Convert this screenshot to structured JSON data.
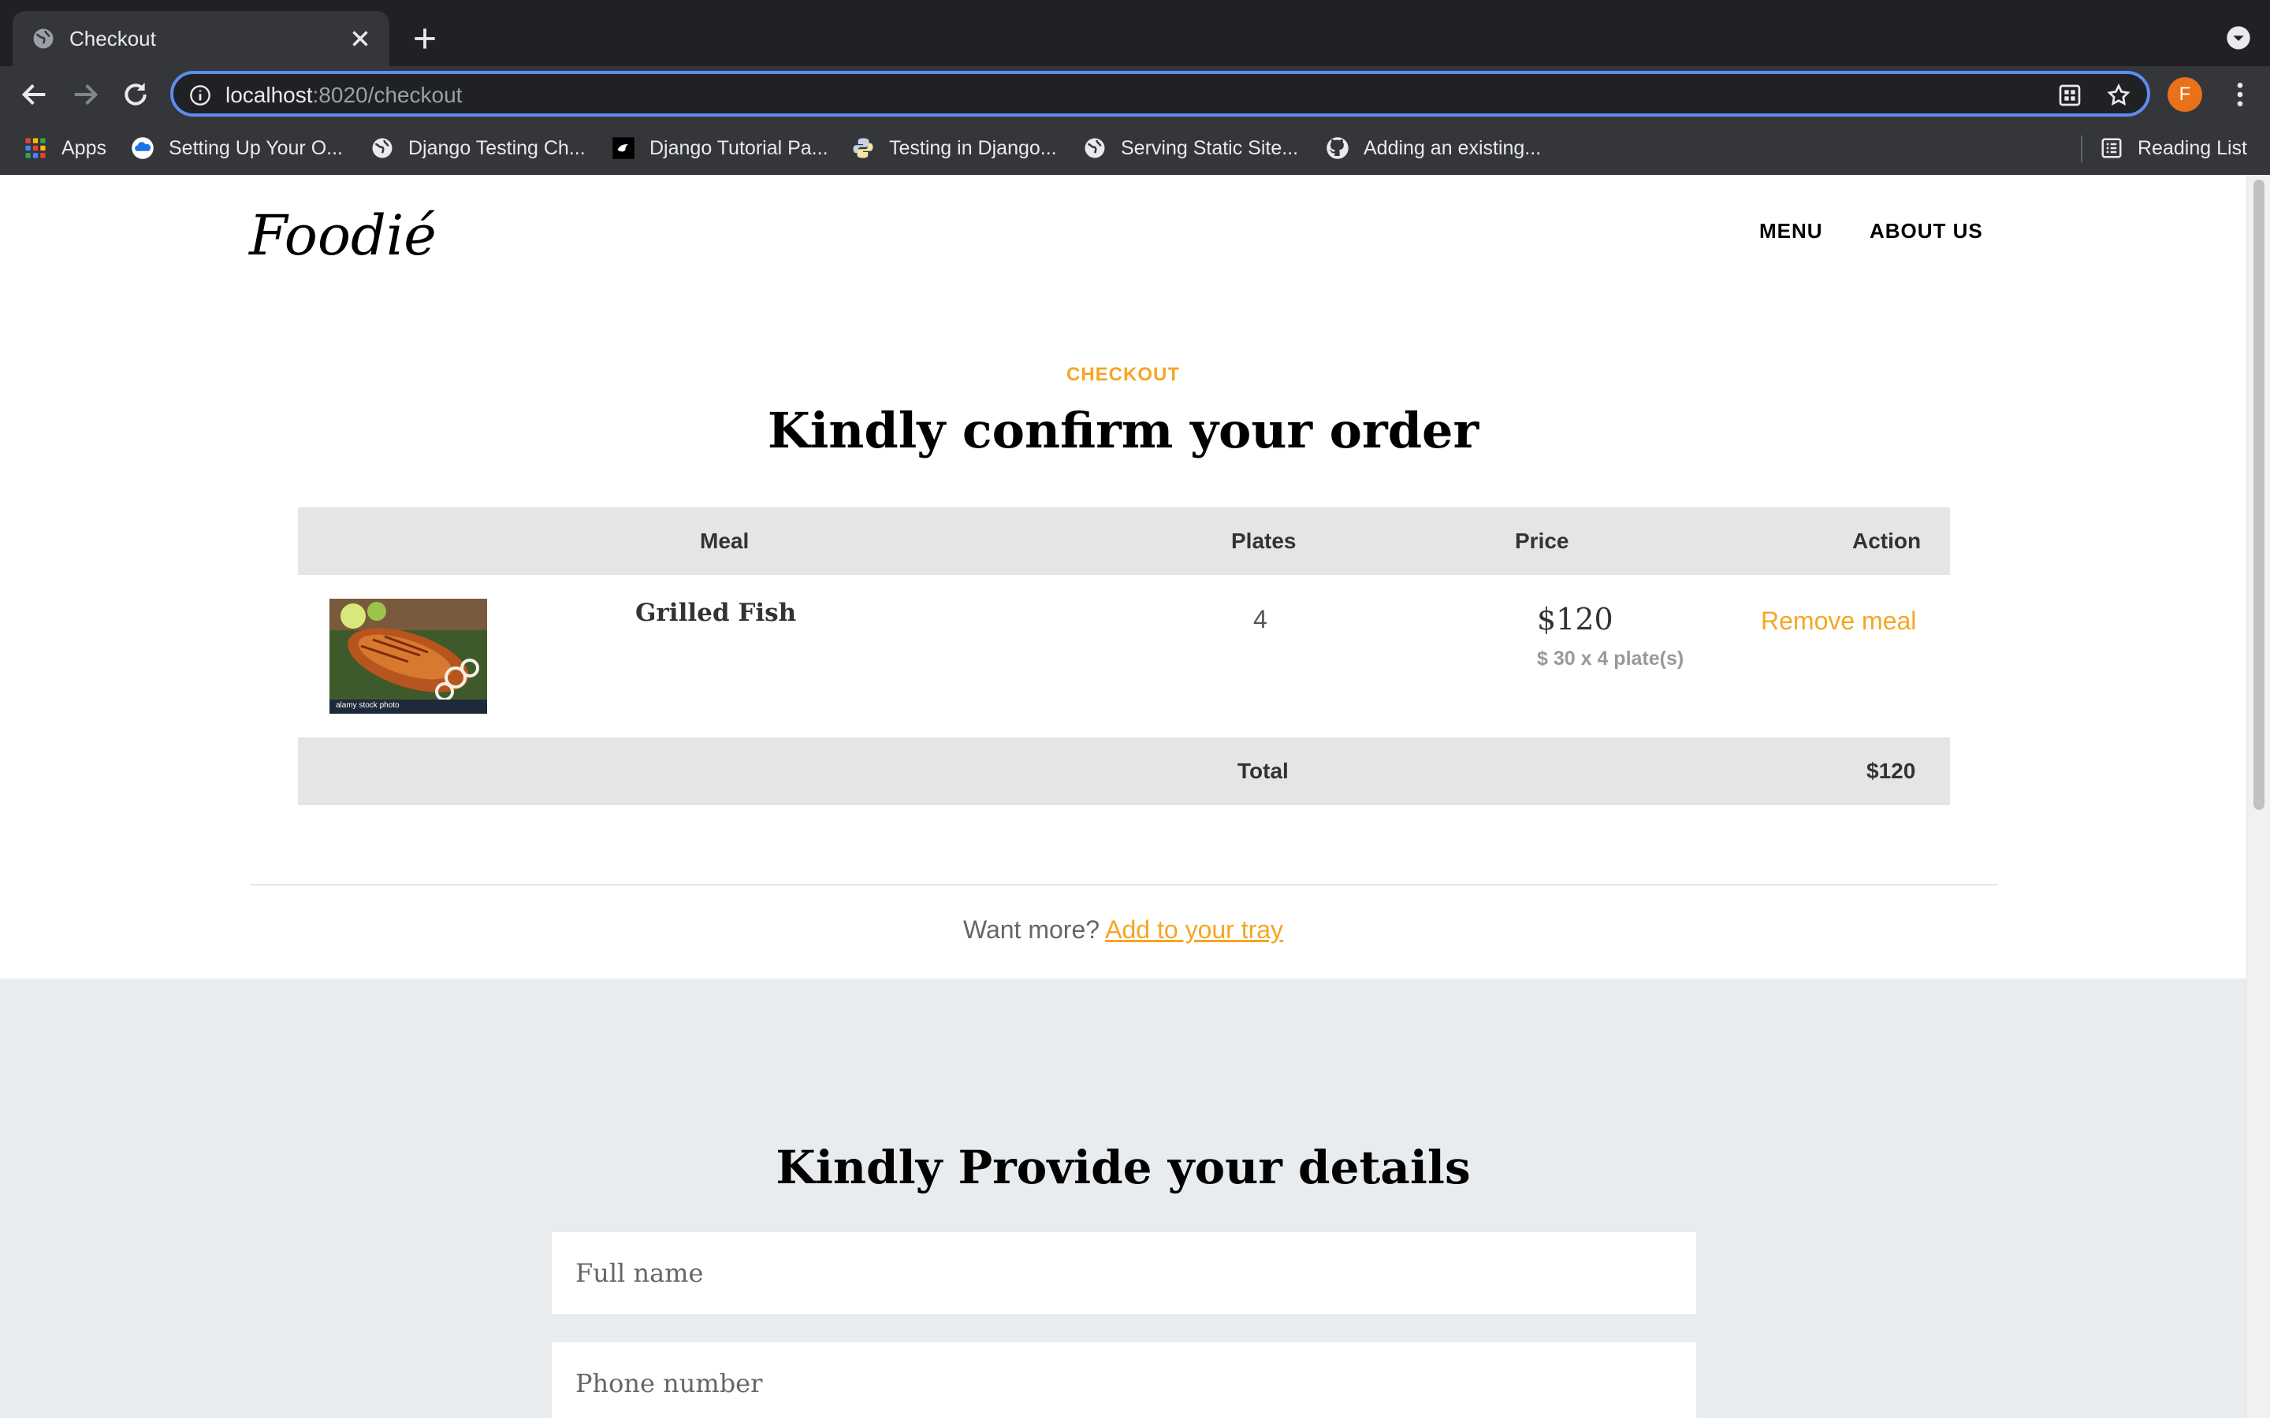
{
  "browser": {
    "tab": {
      "title": "Checkout"
    },
    "url": {
      "host": "localhost",
      "path": ":8020/checkout"
    },
    "profile_initial": "F",
    "bookmarks": [
      {
        "label": "Apps",
        "icon": "apps-grid-icon"
      },
      {
        "label": "Setting Up Your O...",
        "icon": "cloud-icon"
      },
      {
        "label": "Django Testing Ch...",
        "icon": "globe-icon"
      },
      {
        "label": "Django Tutorial Pa...",
        "icon": "django-icon"
      },
      {
        "label": "Testing in Django...",
        "icon": "python-icon"
      },
      {
        "label": "Serving Static Site...",
        "icon": "globe-icon"
      },
      {
        "label": "Adding an existing...",
        "icon": "github-icon"
      }
    ],
    "reading_list": "Reading List"
  },
  "site": {
    "brand": "Foodié",
    "nav": [
      "MENU",
      "ABOUT US"
    ]
  },
  "checkout": {
    "eyebrow": "CHECKOUT",
    "title": "Kindly confirm your order",
    "columns": [
      "Meal",
      "Plates",
      "Price",
      "Action"
    ],
    "items": [
      {
        "meal": "Grilled Fish",
        "plates": "4",
        "price": "$120",
        "price_note": "$ 30 x 4 plate(s)",
        "action": "Remove meal",
        "image_caption": "alamy stock photo"
      }
    ],
    "total_label": "Total",
    "total_value": "$120",
    "more_text": "Want more?",
    "more_link": "Add to your tray"
  },
  "details": {
    "title": "Kindly Provide your details",
    "fullname_placeholder": "Full name",
    "phone_placeholder": "Phone number"
  },
  "colors": {
    "accent": "#f5a623",
    "chrome_dark": "#202124",
    "chrome": "#35363a",
    "focus_ring": "#5b8def",
    "details_bg": "#e9ecef"
  }
}
